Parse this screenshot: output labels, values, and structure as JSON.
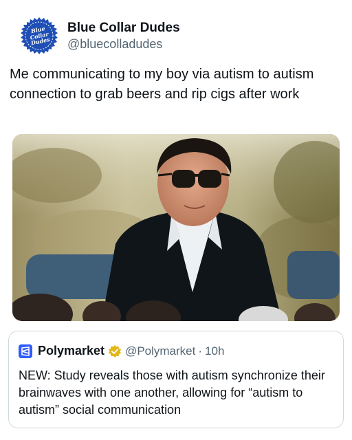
{
  "post": {
    "author": {
      "avatar_text": "Blue Collar Dudes",
      "display_name": "Blue Collar Dudes",
      "handle": "@bluecolladudes"
    },
    "text": "Me communicating to my boy via autism to autism connection to grab beers and rip cigs after work",
    "media": {
      "icon": "photo-man-sunglasses-suit"
    }
  },
  "quote": {
    "logo_icon": "polymarket-logo-icon",
    "display_name": "Polymarket",
    "verified": true,
    "verified_icon": "gold-verified-badge-icon",
    "handle": "@Polymarket",
    "separator": "·",
    "time": "10h",
    "text": "NEW: Study reveals those with autism synchronize their brainwaves with one another, allowing for “autism to autism” social communication"
  },
  "colors": {
    "avatar_blue": "#1f4fb5",
    "verified_gold": "#e2b719",
    "polymarket_blue": "#2e5cff",
    "secondary_text": "#536471"
  }
}
